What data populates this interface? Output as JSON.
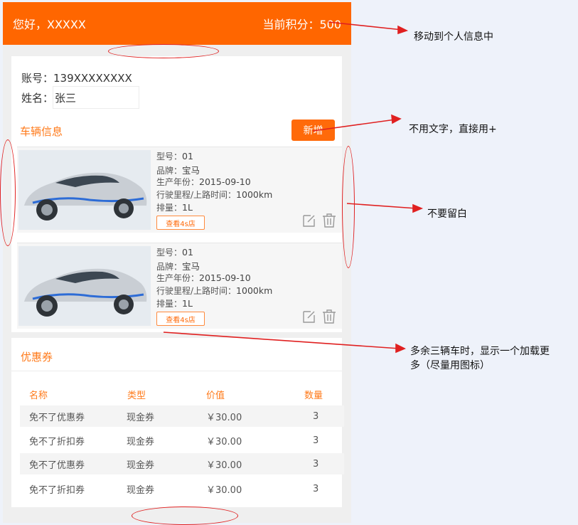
{
  "header": {
    "greeting": "您好，XXXXX",
    "points_label": "当前积分：500"
  },
  "account": {
    "account_label": "账号：139XXXXXXXX",
    "name_label": "姓名：",
    "name_value": "张三"
  },
  "vehicles": {
    "title": "车辆信息",
    "add_label": "新增",
    "items": [
      {
        "model_label": "型号：",
        "model": "01",
        "brand_label": "品牌：",
        "brand": "宝马",
        "year_label": "生产年份：",
        "year": "2015-09-10",
        "mileage_label": "行驶里程/上路时间：",
        "mileage": "1000km",
        "displacement_label": "排量：",
        "displacement": "1L",
        "shop_label": "查看4s店"
      },
      {
        "model_label": "型号：",
        "model": "01",
        "brand_label": "品牌：",
        "brand": "宝马",
        "year_label": "生产年份：",
        "year": "2015-09-10",
        "mileage_label": "行驶里程/上路时间：",
        "mileage": "1000km",
        "displacement_label": "排量：",
        "displacement": "1L",
        "shop_label": "查看4s店"
      }
    ]
  },
  "coupons": {
    "title": "优惠券",
    "columns": [
      "名称",
      "类型",
      "价值",
      "数量"
    ],
    "rows": [
      [
        "免不了优惠券",
        "现金券",
        "￥30.00",
        "3"
      ],
      [
        "免不了折扣券",
        "现金券",
        "￥30.00",
        "3"
      ],
      [
        "免不了优惠券",
        "现金券",
        "￥30.00",
        "3"
      ],
      [
        "免不了折扣券",
        "现金券",
        "￥30.00",
        "3"
      ]
    ]
  },
  "annotations": {
    "move_to_profile": "移动到个人信息中",
    "use_plus": "不用文字，直接用+",
    "no_blank": "不要留白",
    "load_more_line1": "多余三辆车时，显示一个加载更",
    "load_more_line2": "多（尽量用图标）"
  },
  "colors": {
    "brand": "#ff6600",
    "annotation": "#e02020"
  },
  "icons": [
    "edit-icon",
    "trash-icon"
  ]
}
